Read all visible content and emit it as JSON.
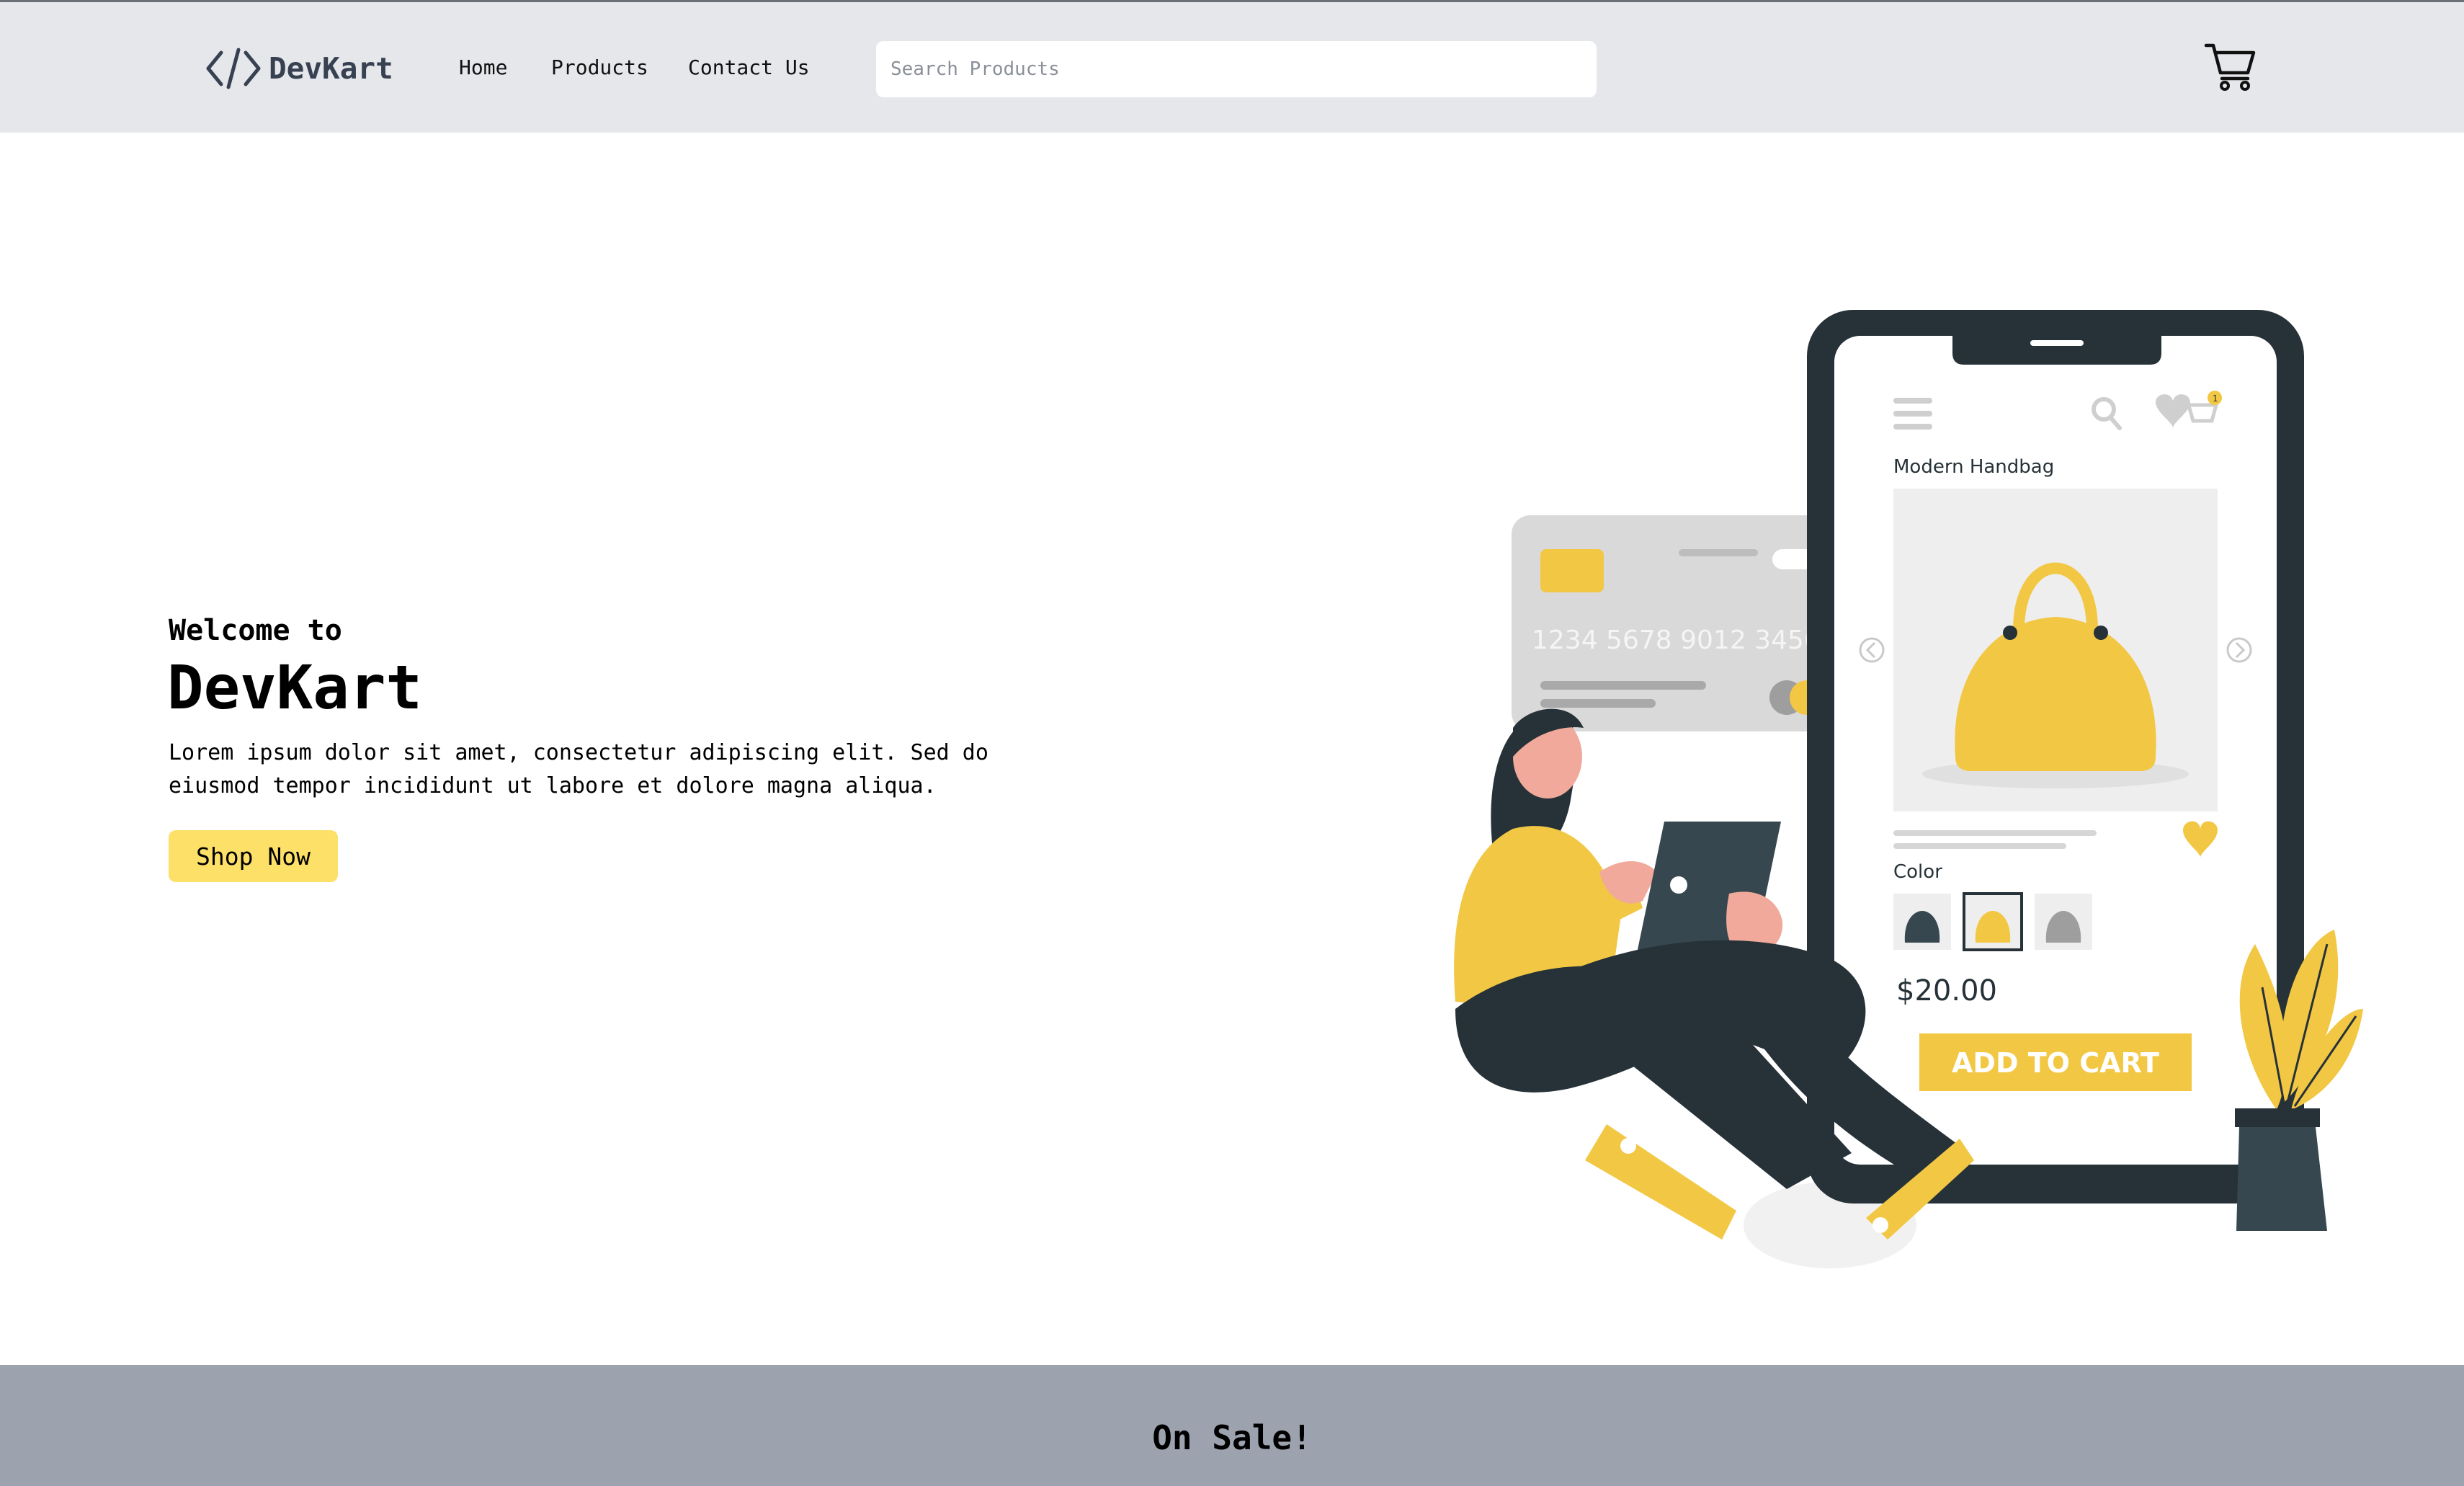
{
  "header": {
    "brand_name": "DevKart",
    "brand_icon": "code-brackets-icon",
    "nav": {
      "home": "Home",
      "products": "Products",
      "contact": "Contact Us"
    },
    "search_placeholder": "Search Products",
    "cart_icon": "shopping-cart-icon"
  },
  "hero": {
    "welcome": "Welcome to",
    "title": "DevKart",
    "description": "Lorem ipsum dolor sit amet, consectetur adipiscing elit. Sed do eiusmod tempor incididunt ut labore et dolore magna aliqua.",
    "cta": "Shop Now"
  },
  "illustration": {
    "card_number": "1234 5678 9012 3456",
    "phone_product_name": "Modern Handbag",
    "phone_color_label": "Color",
    "phone_price": "$20.00",
    "phone_add_to_cart": "ADD TO CART",
    "phone_cart_badge": "1"
  },
  "sale": {
    "title": "On Sale!"
  },
  "colors": {
    "navbar_bg": "#e5e7eb",
    "accent_yellow": "#fde068",
    "illustration_yellow": "#f2c744",
    "dark_slate": "#263238",
    "sale_band_bg": "#9ca3af"
  }
}
